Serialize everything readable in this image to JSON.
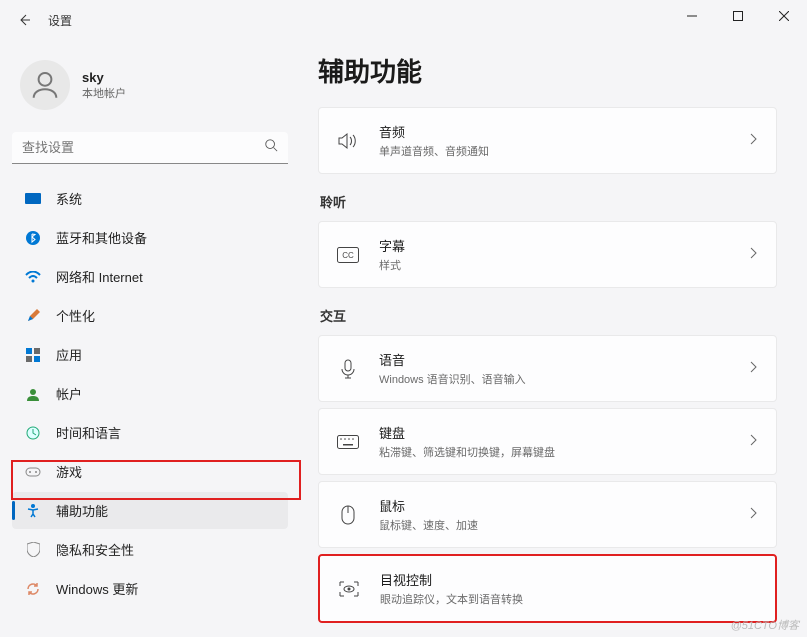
{
  "titlebar": {
    "title": "设置"
  },
  "account": {
    "name": "sky",
    "sub": "本地帐户"
  },
  "search": {
    "placeholder": "查找设置"
  },
  "nav": {
    "system": "系统",
    "bluetooth": "蓝牙和其他设备",
    "network": "网络和 Internet",
    "personalize": "个性化",
    "apps": "应用",
    "accounts": "帐户",
    "time": "时间和语言",
    "gaming": "游戏",
    "accessibility": "辅助功能",
    "privacy": "隐私和安全性",
    "update": "Windows 更新"
  },
  "page": {
    "title": "辅助功能"
  },
  "sections": {
    "hearing": "聆听",
    "interaction": "交互"
  },
  "cards": {
    "audio": {
      "t": "音频",
      "d": "单声道音频、音频通知"
    },
    "captions": {
      "t": "字幕",
      "d": "样式"
    },
    "speech": {
      "t": "语音",
      "d": "Windows 语音识别、语音输入"
    },
    "keyboard": {
      "t": "键盘",
      "d": "粘滞键、筛选键和切换键，屏幕键盘"
    },
    "mouse": {
      "t": "鼠标",
      "d": "鼠标键、速度、加速"
    },
    "eye": {
      "t": "目视控制",
      "d": "眼动追踪仪，文本到语音转换"
    }
  },
  "watermark": "@51CTO博客"
}
